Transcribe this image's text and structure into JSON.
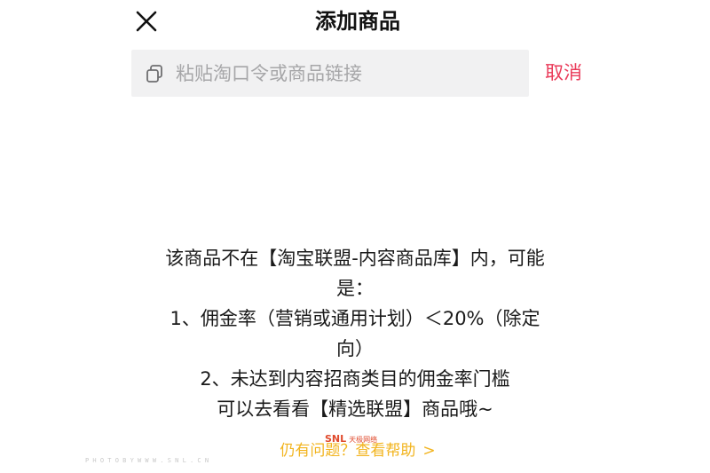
{
  "header": {
    "title": "添加商品",
    "close_icon": "close-icon"
  },
  "search": {
    "icon": "paste-icon",
    "placeholder": "粘贴淘口令或商品链接",
    "value": "",
    "cancel_label": "取消"
  },
  "message": {
    "lines": [
      "该商品不在【淘宝联盟-内容商品库】内，可能",
      "是：",
      "1、佣金率（营销或通用计划）＜20%（除定",
      "向）",
      "2、未达到内容招商类目的佣金率门槛",
      "可以去看看【精选联盟】商品哦~"
    ]
  },
  "help": {
    "label": "仍有问题？查看帮助",
    "chevron": ">"
  },
  "watermark": {
    "logo": "SNL",
    "logo_sub": "天极网络",
    "line": "P H O T O   B Y   W W W . S N L . C N"
  },
  "colors": {
    "accent_red": "#ea3a59",
    "help_yellow": "#f2b41e",
    "search_bg": "#f1f1f2",
    "placeholder": "#a6a6a8"
  }
}
